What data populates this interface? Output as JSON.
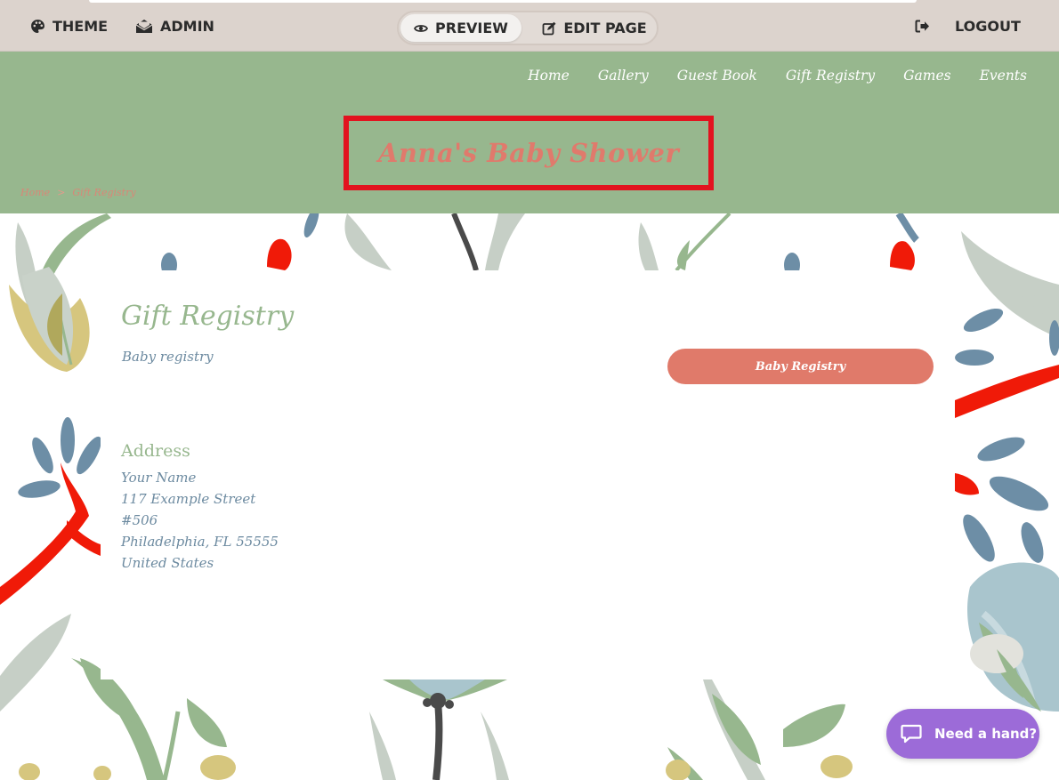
{
  "admin_bar": {
    "theme_label": "THEME",
    "admin_label": "ADMIN",
    "preview_label": "PREVIEW",
    "edit_label": "EDIT PAGE",
    "logout_label": "LOGOUT"
  },
  "nav": {
    "items": [
      "Home",
      "Gallery",
      "Guest Book",
      "Gift Registry",
      "Games",
      "Events"
    ]
  },
  "header": {
    "title": "Anna's Baby Shower",
    "breadcrumb": [
      "Home",
      "Gift Registry"
    ],
    "breadcrumb_sep": ">"
  },
  "content": {
    "heading": "Gift Registry",
    "subtitle": "Baby registry",
    "button_label": "Baby Registry",
    "address_heading": "Address",
    "address_lines": [
      "Your Name",
      "117 Example Street",
      "#506",
      "Philadelphia, FL 55555",
      "United States"
    ]
  },
  "help": {
    "label": "Need a hand?"
  },
  "colors": {
    "header_green": "#97b78e",
    "accent_coral": "#e07a6a",
    "text_blue": "#6c8aa0",
    "highlight_red": "#e2131f",
    "help_purple": "#9c6bd8"
  }
}
